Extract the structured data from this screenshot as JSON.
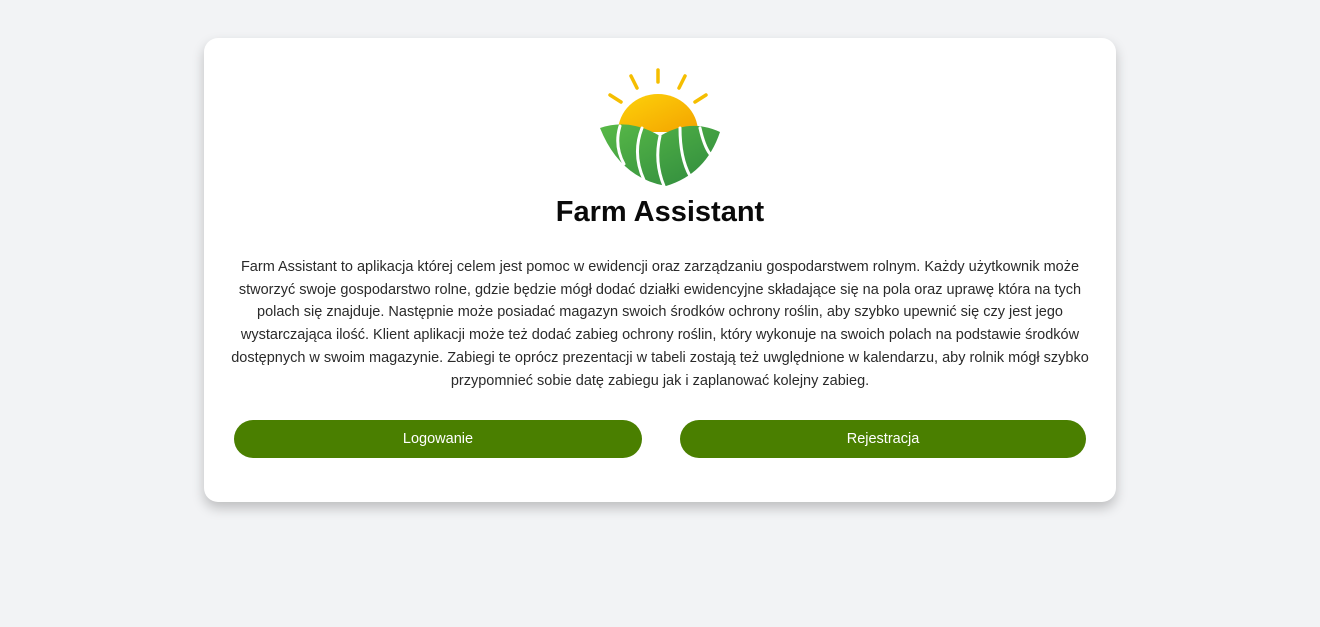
{
  "app": {
    "title": "Farm Assistant",
    "description": "Farm Assistant to aplikacja której celem jest pomoc w ewidencji oraz zarządzaniu gospodarstwem rolnym. Każdy użytkownik może stworzyć swoje gospodarstwo rolne, gdzie będzie mógł dodać działki ewidencyjne składające się na pola oraz uprawę która na tych polach się znajduje. Następnie może posiadać magazyn swoich środków ochrony roślin, aby szybko upewnić się czy jest jego wystarczająca ilość. Klient aplikacji może też dodać zabieg ochrony roślin, który wykonuje na swoich polach na podstawie środków dostępnych w swoim magazynie. Zabiegi te oprócz prezentacji w tabeli zostają też uwględnione w kalendarzu, aby rolnik mógł szybko przypomnieć sobie datę zabiegu jak i zaplanować kolejny zabieg."
  },
  "logo": {
    "icon": "sun-over-fields-logo",
    "sun_color": "#f7b500",
    "field_color": "#3f9e3f"
  },
  "actions": {
    "login_label": "Logowanie",
    "register_label": "Rejestracja",
    "button_color": "#4a7f00"
  }
}
